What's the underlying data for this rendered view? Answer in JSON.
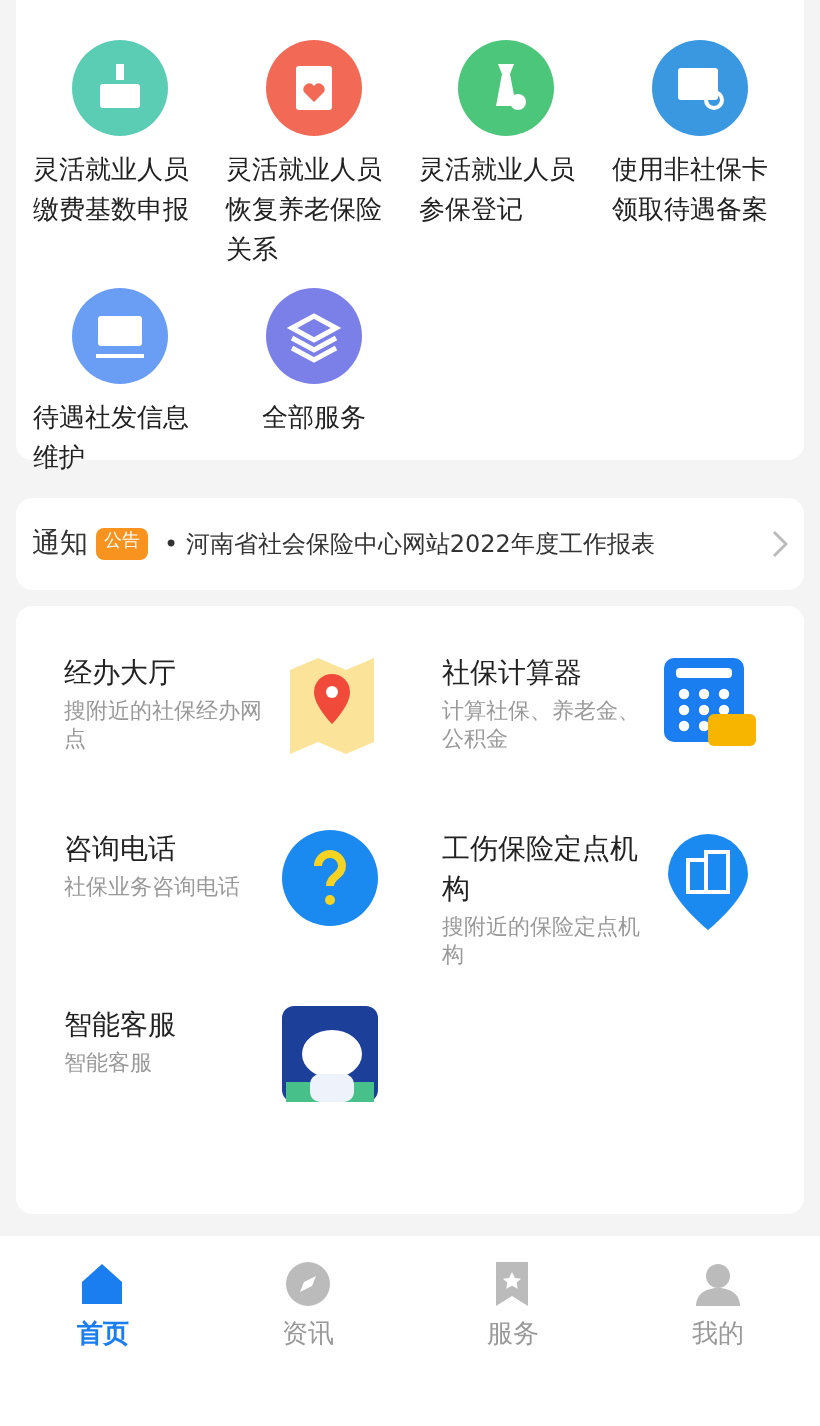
{
  "quick_services": [
    {
      "label": "灵活就业人员缴费基数申报",
      "kind": "card",
      "color": "#5ccdb5"
    },
    {
      "label": "灵活就业人员恢复养老保险关系",
      "kind": "heart",
      "color": "#f26a55"
    },
    {
      "label": "灵活就业人员参保登记",
      "kind": "tie",
      "color": "#4cc67a"
    },
    {
      "label": "使用非社保卡领取待遇备案",
      "kind": "job",
      "color": "#3a98e0"
    },
    {
      "label": "待遇社发信息维护",
      "kind": "id",
      "color": "#6a9ef5"
    },
    {
      "label": "全部服务",
      "kind": "layers",
      "color": "#7b7fe8"
    }
  ],
  "notice": {
    "title": "通知",
    "badge": "公告",
    "text": "• 河南省社会保险中心网站2022年度工作报表"
  },
  "features": [
    {
      "title": "经办大厅",
      "subtitle": "搜附近的社保经办网点",
      "kind": "map"
    },
    {
      "title": "社保计算器",
      "subtitle": "计算社保、养老金、公积金",
      "kind": "calculator"
    },
    {
      "title": "咨询电话",
      "subtitle": "社保业务咨询电话",
      "kind": "question"
    },
    {
      "title": "工伤保险定点机构",
      "subtitle": "搜附近的保险定点机构",
      "kind": "building"
    },
    {
      "title": "智能客服",
      "subtitle": "智能客服",
      "kind": "robot"
    }
  ],
  "tab_bar": [
    {
      "label": "首页",
      "kind": "home",
      "selected": true
    },
    {
      "label": "资讯",
      "kind": "compass",
      "selected": false
    },
    {
      "label": "服务",
      "kind": "bookmark",
      "selected": false
    },
    {
      "label": "我的",
      "kind": "person",
      "selected": false
    }
  ]
}
